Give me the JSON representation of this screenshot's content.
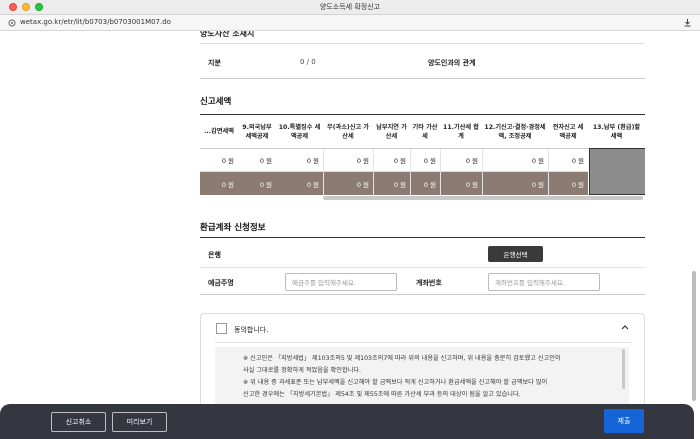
{
  "window": {
    "title": "양도소득세 확정신고"
  },
  "browser": {
    "url": "wetax.go.kr/etr/lit/b0703/b0703001M07.do"
  },
  "top_section": {
    "partial_heading": "양도자산 소재지",
    "share_label": "지분",
    "share_value": "0 / 0",
    "relation_label": "양도인과의 관계"
  },
  "tax_section": {
    "title": "신고세액",
    "columns": [
      {
        "header": "...감면세액",
        "row1": "0 원",
        "row2": "0 원"
      },
      {
        "header": "9.외국납부 세액공제",
        "row1": "0 원",
        "row2": "0 원"
      },
      {
        "header": "10.특별징수 세액공제",
        "row1": "0 원",
        "row2": "0 원"
      },
      {
        "header": "무(과소)신고 가산세",
        "row1": "0 원",
        "row2": "0 원"
      },
      {
        "header": "납부지연 가산세",
        "row1": "0 원",
        "row2": "0 원"
      },
      {
        "header": "기타 가산세",
        "row1": "0 원",
        "row2": "0 원"
      },
      {
        "header": "11.가산세 합계",
        "row1": "0 원",
        "row2": "0 원"
      },
      {
        "header": "12.기신고·결정·경정세액, 조정공제",
        "row1": "0 원",
        "row2": "0 원"
      },
      {
        "header": "전자신고 세액공제",
        "row1": "0 원",
        "row2": "0 원"
      },
      {
        "header": "13.납부 (환급)할 세액",
        "row1": "",
        "row2": ""
      }
    ]
  },
  "refund_section": {
    "title": "환급계좌 신청정보",
    "bank_label": "은행",
    "bank_button": "은행선택",
    "holder_label": "예금주명",
    "holder_placeholder": "예금주를 입력해주세요.",
    "account_label": "계좌번호",
    "account_placeholder": "계좌번호를 입력해주세요."
  },
  "agreement": {
    "checkbox_label": "동의합니다.",
    "lines": [
      "※ 신고인은 「지방세법」 제103조의5 및 제103조의7에 따라 위의 내용을 신고하며, 위 내용을 충분히 검토했고 신고인이",
      "사실 그대로를 정확하게 적었음을 확인합니다.",
      "※ 위 내용 중 과세표준 또는 납부세액을 신고해야 할 금액보다 적게 신고하거나 환급세액을 신고해야 할 금액보다 많이",
      "신고한 경우에는 「지방세기본법」 제54조 및 제55조에 따른 가산세 부과 등의 대상이 됨을 알고 있습니다."
    ]
  },
  "bottom_bar": {
    "cancel_label": "신고취소",
    "preview_label": "미리보기",
    "submit_label": "제출"
  }
}
